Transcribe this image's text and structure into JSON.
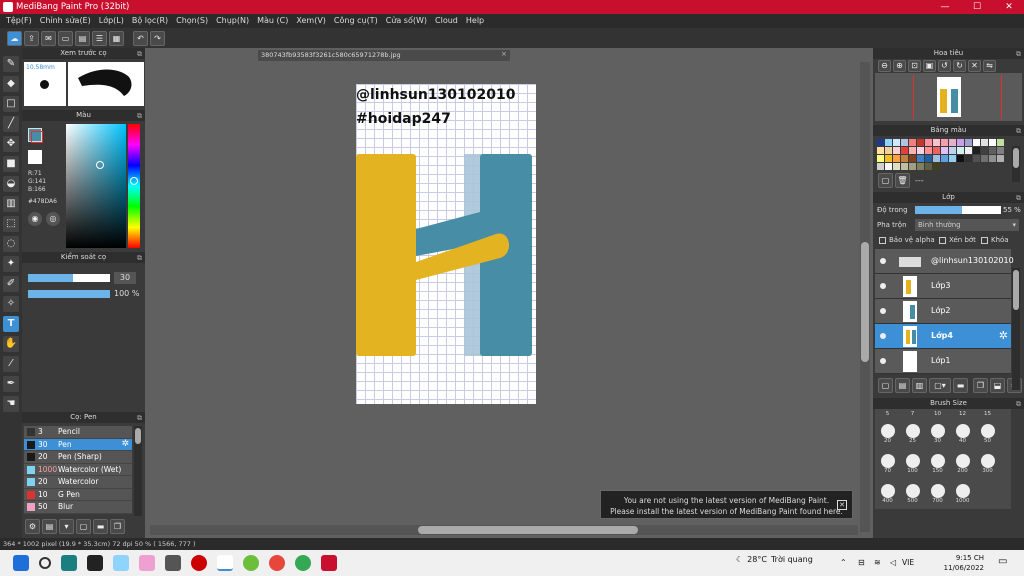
{
  "window": {
    "title": "MediBang Paint Pro (32bit)",
    "minimize": "—",
    "maximize": "☐",
    "close": "✕"
  },
  "menu": [
    "Tệp(F)",
    "Chỉnh sửa(E)",
    "Lớp(L)",
    "Bộ lọc(R)",
    "Chọn(S)",
    "Chụp(N)",
    "Màu (C)",
    "Xem(V)",
    "Công cụ(T)",
    "Cửa số(W)",
    "Cloud",
    "Help"
  ],
  "document": {
    "tab_name": "380743fb93583f3261c580c65971278b.jpg",
    "text_line1": "@linhsun130102010",
    "text_line2": "#hoidap247"
  },
  "preview_panel": {
    "title": "Xem trước cọ",
    "size_label": "10.58mm"
  },
  "color_panel": {
    "title": "Màu",
    "r": "R:71",
    "g": "G:141",
    "b": "B:166",
    "hex": "#478DA6",
    "colors": {
      "main": "#478DA6"
    }
  },
  "brush_control": {
    "title": "Kiểm soát cọ",
    "size_value": "30",
    "opacity_value": "100 %"
  },
  "brush_list": {
    "title": "Cọ: Pen",
    "items": [
      {
        "num": "3",
        "name": "Pencil",
        "color": "#333333"
      },
      {
        "num": "30",
        "name": "Pen",
        "color": "#1a1a1a"
      },
      {
        "num": "20",
        "name": "Pen (Sharp)",
        "color": "#1a1a1a"
      },
      {
        "num": "1000",
        "name": "Watercolor (Wet)",
        "color": "#7fd3f0"
      },
      {
        "num": "20",
        "name": "Watercolor",
        "color": "#7fd3f0"
      },
      {
        "num": "10",
        "name": "G Pen",
        "color": "#e03030"
      },
      {
        "num": "50",
        "name": "Blur",
        "color": "#f0a0c0"
      }
    ]
  },
  "navigator": {
    "title": "Hoa tiêu"
  },
  "palette": {
    "title": "Bảng màu",
    "ellipsis": "---"
  },
  "layer_panel": {
    "title": "Lớp",
    "opacity_label": "Độ trong",
    "opacity_value": "55 %",
    "opacity_fraction": 0.55,
    "blend_label": "Pha trộn",
    "blend_value": "Bình thường",
    "protect_alpha": "Bảo vệ alpha",
    "clipping": "Xén bớt",
    "lock": "Khóa",
    "layers": [
      {
        "name": "@linhsun130102010",
        "selected": false
      },
      {
        "name": "Lớp3",
        "selected": false
      },
      {
        "name": "Lớp2",
        "selected": false
      },
      {
        "name": "Lớp4",
        "selected": true
      },
      {
        "name": "Lớp1",
        "selected": false
      }
    ]
  },
  "brush_size": {
    "title": "Brush Size",
    "top_row": [
      "5",
      "7",
      "10",
      "12",
      "15"
    ],
    "rows": [
      [
        "20",
        "25",
        "30",
        "40",
        "50"
      ],
      [
        "70",
        "100",
        "150",
        "200",
        "300"
      ],
      [
        "400",
        "500",
        "700",
        "1000",
        ""
      ]
    ]
  },
  "toast": {
    "line1": "You are not using the latest version of MediBang Paint.",
    "line2": "Please install the latest version of MediBang Paint found here.",
    "close": "✕"
  },
  "status": {
    "text": "364 * 1002 pixel   (19.9 * 35.3cm)   72 dpi   50 %   ( 1566, 777 )"
  },
  "taskbar": {
    "weather_temp": "28°C",
    "weather_text": "Trời quang",
    "lang": "VIE",
    "time": "9:15 CH",
    "date": "11/06/2022"
  }
}
